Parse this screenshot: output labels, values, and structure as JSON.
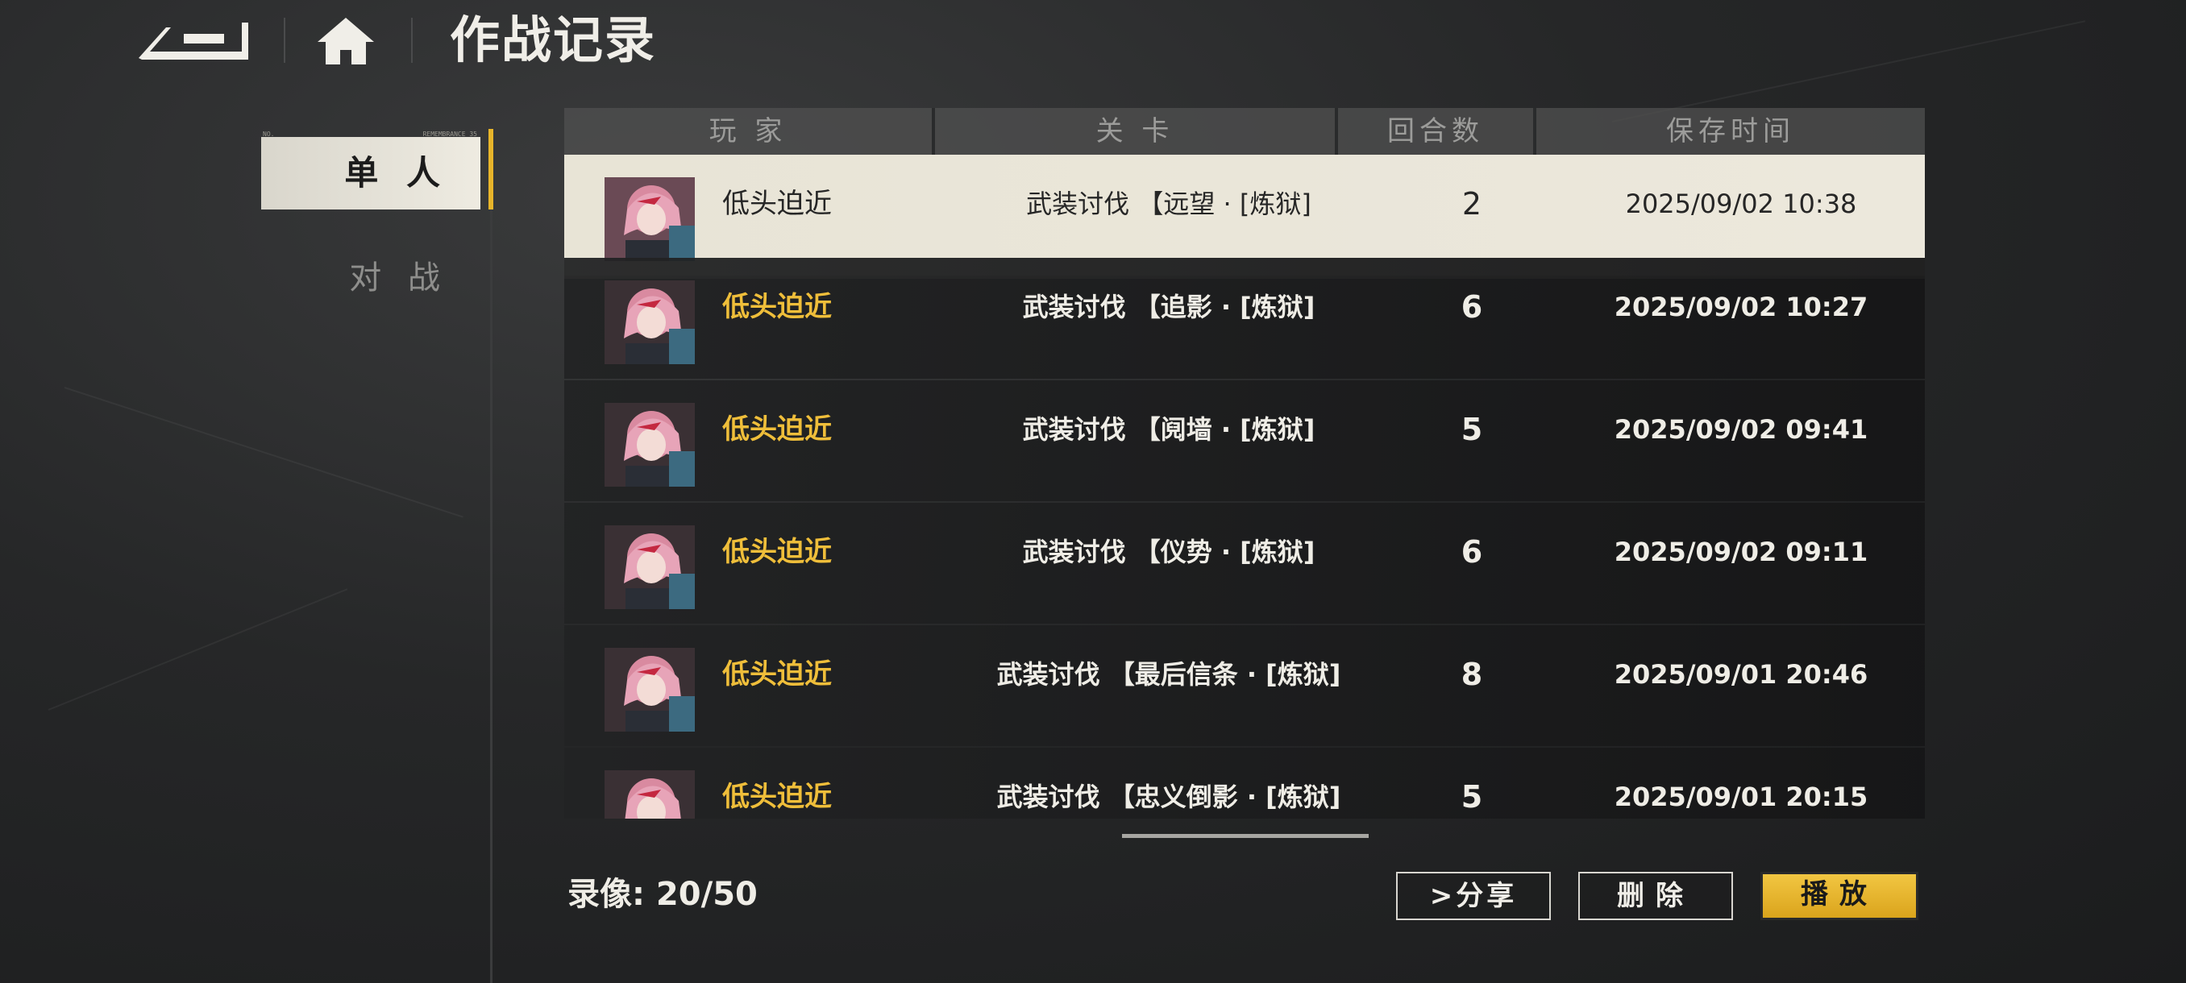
{
  "header": {
    "title": "作战记录"
  },
  "nav": {
    "single_label": "单 人",
    "battle_label": "对 战"
  },
  "table": {
    "columns": [
      "玩 家",
      "关 卡",
      "回合数",
      "保存时间"
    ],
    "rows": [
      {
        "player": "低头迫近",
        "stage": "武装讨伐 【远望 · [炼狱]",
        "turns": "2",
        "time": "2025/09/02 10:38",
        "selected": true
      },
      {
        "player": "低头迫近",
        "stage": "武装讨伐 【追影 · [炼狱]",
        "turns": "6",
        "time": "2025/09/02 10:27"
      },
      {
        "player": "低头迫近",
        "stage": "武装讨伐 【阋墙 · [炼狱]",
        "turns": "5",
        "time": "2025/09/02 09:41"
      },
      {
        "player": "低头迫近",
        "stage": "武装讨伐 【仪势 · [炼狱]",
        "turns": "6",
        "time": "2025/09/02 09:11"
      },
      {
        "player": "低头迫近",
        "stage": "武装讨伐 【最后信条 · [炼狱]",
        "turns": "8",
        "time": "2025/09/01 20:46"
      },
      {
        "player": "低头迫近",
        "stage": "武装讨伐 【忠义倒影 · [炼狱]",
        "turns": "5",
        "time": "2025/09/01 20:15"
      }
    ]
  },
  "footer": {
    "record_count": "录像: 20/50",
    "share_label": ">分享",
    "delete_label": "删除",
    "play_label": "播放"
  },
  "colors": {
    "accent": "#efbe3a",
    "selected_row": "#ece8dc"
  }
}
